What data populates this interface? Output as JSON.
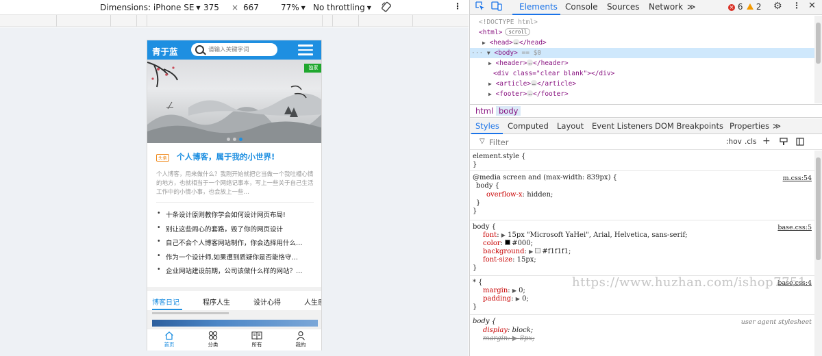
{
  "device_toolbar": {
    "dimensions_label": "Dimensions: iPhone SE",
    "width": "375",
    "times": "×",
    "height": "667",
    "zoom": "77%",
    "throttling": "No throttling"
  },
  "mobile_page": {
    "logo": "青于蓝",
    "search_placeholder": "请输入关键字词",
    "banner_badge": "独家",
    "carousel": {
      "slide_count": 3,
      "active_slide": 3
    },
    "headline_tag": "头条",
    "headline": "个人博客，属于我的小世界!",
    "summary": "个人博客，用来做什么？我刚开始就把它当做一个我吐槽心情的地方，也就相当于一个网络记事本，写上一些关于自己生活工作中的小情小事，也会放上一些…",
    "articles": [
      "十条设计原则教你学会如何设计网页布局!",
      "别让这些闹心的套路，毁了你的网页设计",
      "自己不会个人博客网站制作，你会选择用什么…",
      "作为一个设计师,如果遭到质疑你是否能恪守…",
      "企业网站建设前期，公司该做什么样的网站？…"
    ],
    "tabs": [
      "博客日记",
      "程序人生",
      "设计心得",
      "人生感"
    ],
    "active_tab": "博客日记",
    "footer_nav": [
      {
        "label": "首页",
        "icon": "home-icon",
        "active": true
      },
      {
        "label": "分类",
        "icon": "grid-icon",
        "active": false
      },
      {
        "label": "所有",
        "icon": "book-icon",
        "active": false
      },
      {
        "label": "我的",
        "icon": "user-icon",
        "active": false
      }
    ],
    "accent_color": "#1e8fe1"
  },
  "devtools": {
    "tabs": [
      "Elements",
      "Console",
      "Sources",
      "Network"
    ],
    "active_tab": "Elements",
    "error_count": "6",
    "warning_count": "2",
    "dom": {
      "doctype": "<!DOCTYPE html>",
      "html_open": "<html>",
      "scroll_badge": "scroll",
      "head": "<head>",
      "head_close": "</head>",
      "body_open": "<body>",
      "body_ref": "== $0",
      "header": "<header>",
      "header_close": "</header>",
      "div_line": "<div class=\"clear blank\"></div>",
      "article": "<article>",
      "article_close": "</article>",
      "footer": "<footer>",
      "footer_close": "</footer>",
      "ellipsis": "…"
    },
    "breadcrumb": [
      "html",
      "body"
    ],
    "sub_tabs": [
      "Styles",
      "Computed",
      "Layout",
      "Event Listeners",
      "DOM Breakpoints",
      "Properties"
    ],
    "active_sub_tab": "Styles",
    "filter_placeholder": "Filter",
    "filter_hov": ":hov",
    "filter_cls": ".cls",
    "styles": {
      "element_style": "element.style {",
      "close_brace": "}",
      "media_query": "@media screen and (max-width: 839px) {",
      "media_src": "m.css:54",
      "body_selector": "body {",
      "overflow_prop": "overflow-x",
      "overflow_val": "hidden;",
      "body_src": "base.css:5",
      "font_prop": "font",
      "font_val": "15px \"Microsoft YaHei\", Arial, Helvetica, sans-serif;",
      "color_prop": "color",
      "color_val": "#000;",
      "bg_prop": "background",
      "bg_val": "#f1f1f1;",
      "fontsize_prop": "font-size",
      "fontsize_val": "15px;",
      "star_selector": "* {",
      "star_src": "base.css:4",
      "margin_prop": "margin",
      "margin_val": "0;",
      "padding_prop": "padding",
      "padding_val": "0;",
      "ua_selector": "body {",
      "ua_label": "user agent stylesheet",
      "display_prop": "display",
      "display_val": "block;",
      "ua_margin_prop": "margin",
      "ua_margin_val": "8px;"
    }
  },
  "watermark": "https://www.huzhan.com/ishop7751"
}
